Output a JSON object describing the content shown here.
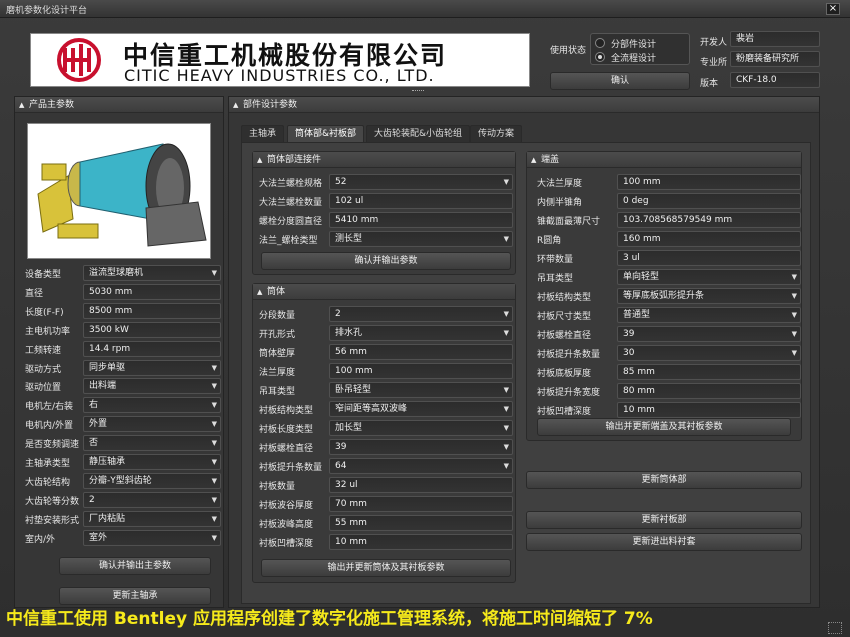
{
  "window": {
    "title": "磨机参数化设计平台",
    "close": "×"
  },
  "logo": {
    "chinese": "中信重工机械股份有限公司",
    "english": "CITIC HEAVY INDUSTRIES CO., LTD."
  },
  "usage": {
    "label": "使用状态",
    "options": [
      "分部件设计",
      "全流程设计"
    ],
    "selected": 1,
    "confirm": "确认"
  },
  "meta": {
    "developer_label": "开发人",
    "developer": "裴岩",
    "dept_label": "专业所",
    "dept": "粉磨装备研究所",
    "version_label": "版本",
    "version": "CKF-18.0"
  },
  "product": {
    "header": "产品主参数",
    "rows": [
      {
        "label": "设备类型",
        "value": "溢流型球磨机",
        "type": "select"
      },
      {
        "label": "直径",
        "value": "5030 mm",
        "type": "text"
      },
      {
        "label": "长度(F-F)",
        "value": "8500 mm",
        "type": "text"
      },
      {
        "label": "主电机功率",
        "value": "3500 kW",
        "type": "text"
      },
      {
        "label": "工频转速",
        "value": "14.4 rpm",
        "type": "text"
      },
      {
        "label": "驱动方式",
        "value": "同步单驱",
        "type": "select"
      },
      {
        "label": "驱动位置",
        "value": "出料端",
        "type": "select"
      },
      {
        "label": "电机左/右装",
        "value": "右",
        "type": "select"
      },
      {
        "label": "电机内/外置",
        "value": "外置",
        "type": "select"
      },
      {
        "label": "是否变频调速",
        "value": "否",
        "type": "select"
      },
      {
        "label": "主轴承类型",
        "value": "静压轴承",
        "type": "select"
      },
      {
        "label": "大齿轮结构",
        "value": "分瓣-Y型斜齿轮",
        "type": "select"
      },
      {
        "label": "大齿轮等分数",
        "value": "2",
        "type": "select"
      },
      {
        "label": "衬垫安装形式",
        "value": "厂内粘贴",
        "type": "select"
      },
      {
        "label": "室内/外",
        "value": "室外",
        "type": "select"
      }
    ],
    "confirm_btn": "确认并输出主参数",
    "update_btn": "更新主轴承"
  },
  "parts": {
    "header": "部件设计参数",
    "tabs": [
      "主轴承",
      "筒体部&衬板部",
      "大齿轮装配&小齿轮组",
      "传动方案"
    ],
    "active_tab": 1
  },
  "flange": {
    "header": "筒体部连接件",
    "rows": [
      {
        "label": "大法兰螺栓规格",
        "value": "52",
        "type": "select"
      },
      {
        "label": "大法兰螺栓数量",
        "value": "102 ul",
        "type": "text"
      },
      {
        "label": "螺栓分度圆直径",
        "value": "5410 mm",
        "type": "text"
      },
      {
        "label": "法兰_螺栓类型",
        "value": "测长型",
        "type": "select"
      }
    ],
    "btn": "确认并输出参数"
  },
  "shell": {
    "header": "筒体",
    "rows": [
      {
        "label": "分段数量",
        "value": "2",
        "type": "select"
      },
      {
        "label": "开孔形式",
        "value": "排水孔",
        "type": "select"
      },
      {
        "label": "筒体壁厚",
        "value": "56 mm",
        "type": "text"
      },
      {
        "label": "法兰厚度",
        "value": "100 mm",
        "type": "text"
      },
      {
        "label": "吊耳类型",
        "value": "卧吊轻型",
        "type": "select"
      },
      {
        "label": "衬板结构类型",
        "value": "窄间距等高双波峰",
        "type": "select"
      },
      {
        "label": "衬板长度类型",
        "value": "加长型",
        "type": "select"
      },
      {
        "label": "衬板螺栓直径",
        "value": "39",
        "type": "select"
      },
      {
        "label": "衬板提升条数量",
        "value": "64",
        "type": "select"
      },
      {
        "label": "衬板数量",
        "value": "32 ul",
        "type": "text"
      },
      {
        "label": "衬板波谷厚度",
        "value": "70 mm",
        "type": "text"
      },
      {
        "label": "衬板波峰高度",
        "value": "55 mm",
        "type": "text"
      },
      {
        "label": "衬板凹槽深度",
        "value": "10 mm",
        "type": "text"
      }
    ],
    "btn": "输出并更新筒体及其衬板参数"
  },
  "endcap": {
    "header": "端盖",
    "rows": [
      {
        "label": "大法兰厚度",
        "value": "100 mm",
        "type": "text"
      },
      {
        "label": "内侧半锥角",
        "value": "0 deg",
        "type": "text"
      },
      {
        "label": "锥截面最薄尺寸",
        "value": "103.708568579549 mm",
        "type": "text"
      },
      {
        "label": "R圆角",
        "value": "160 mm",
        "type": "text"
      },
      {
        "label": "环带数量",
        "value": "3 ul",
        "type": "text"
      },
      {
        "label": "吊耳类型",
        "value": "单向轻型",
        "type": "select"
      },
      {
        "label": "衬板结构类型",
        "value": "等厚底板弧形提升条",
        "type": "select"
      },
      {
        "label": "衬板尺寸类型",
        "value": "普通型",
        "type": "select"
      },
      {
        "label": "衬板螺栓直径",
        "value": "39",
        "type": "select"
      },
      {
        "label": "衬板提升条数量",
        "value": "30",
        "type": "select"
      },
      {
        "label": "衬板底板厚度",
        "value": "85 mm",
        "type": "text"
      },
      {
        "label": "衬板提升条宽度",
        "value": "80 mm",
        "type": "text"
      },
      {
        "label": "衬板凹槽深度",
        "value": "10 mm",
        "type": "text"
      }
    ],
    "btn": "输出并更新端盖及其衬板参数"
  },
  "right_buttons": [
    "更新筒体部",
    "更新衬板部",
    "更新进出料衬套"
  ],
  "caption": "中信重工使用 Bentley 应用程序创建了数字化施工管理系统，将施工时间缩短了 7%",
  "colors": {
    "caption": "#f6ea1b",
    "logo_red": "#c8102e"
  }
}
